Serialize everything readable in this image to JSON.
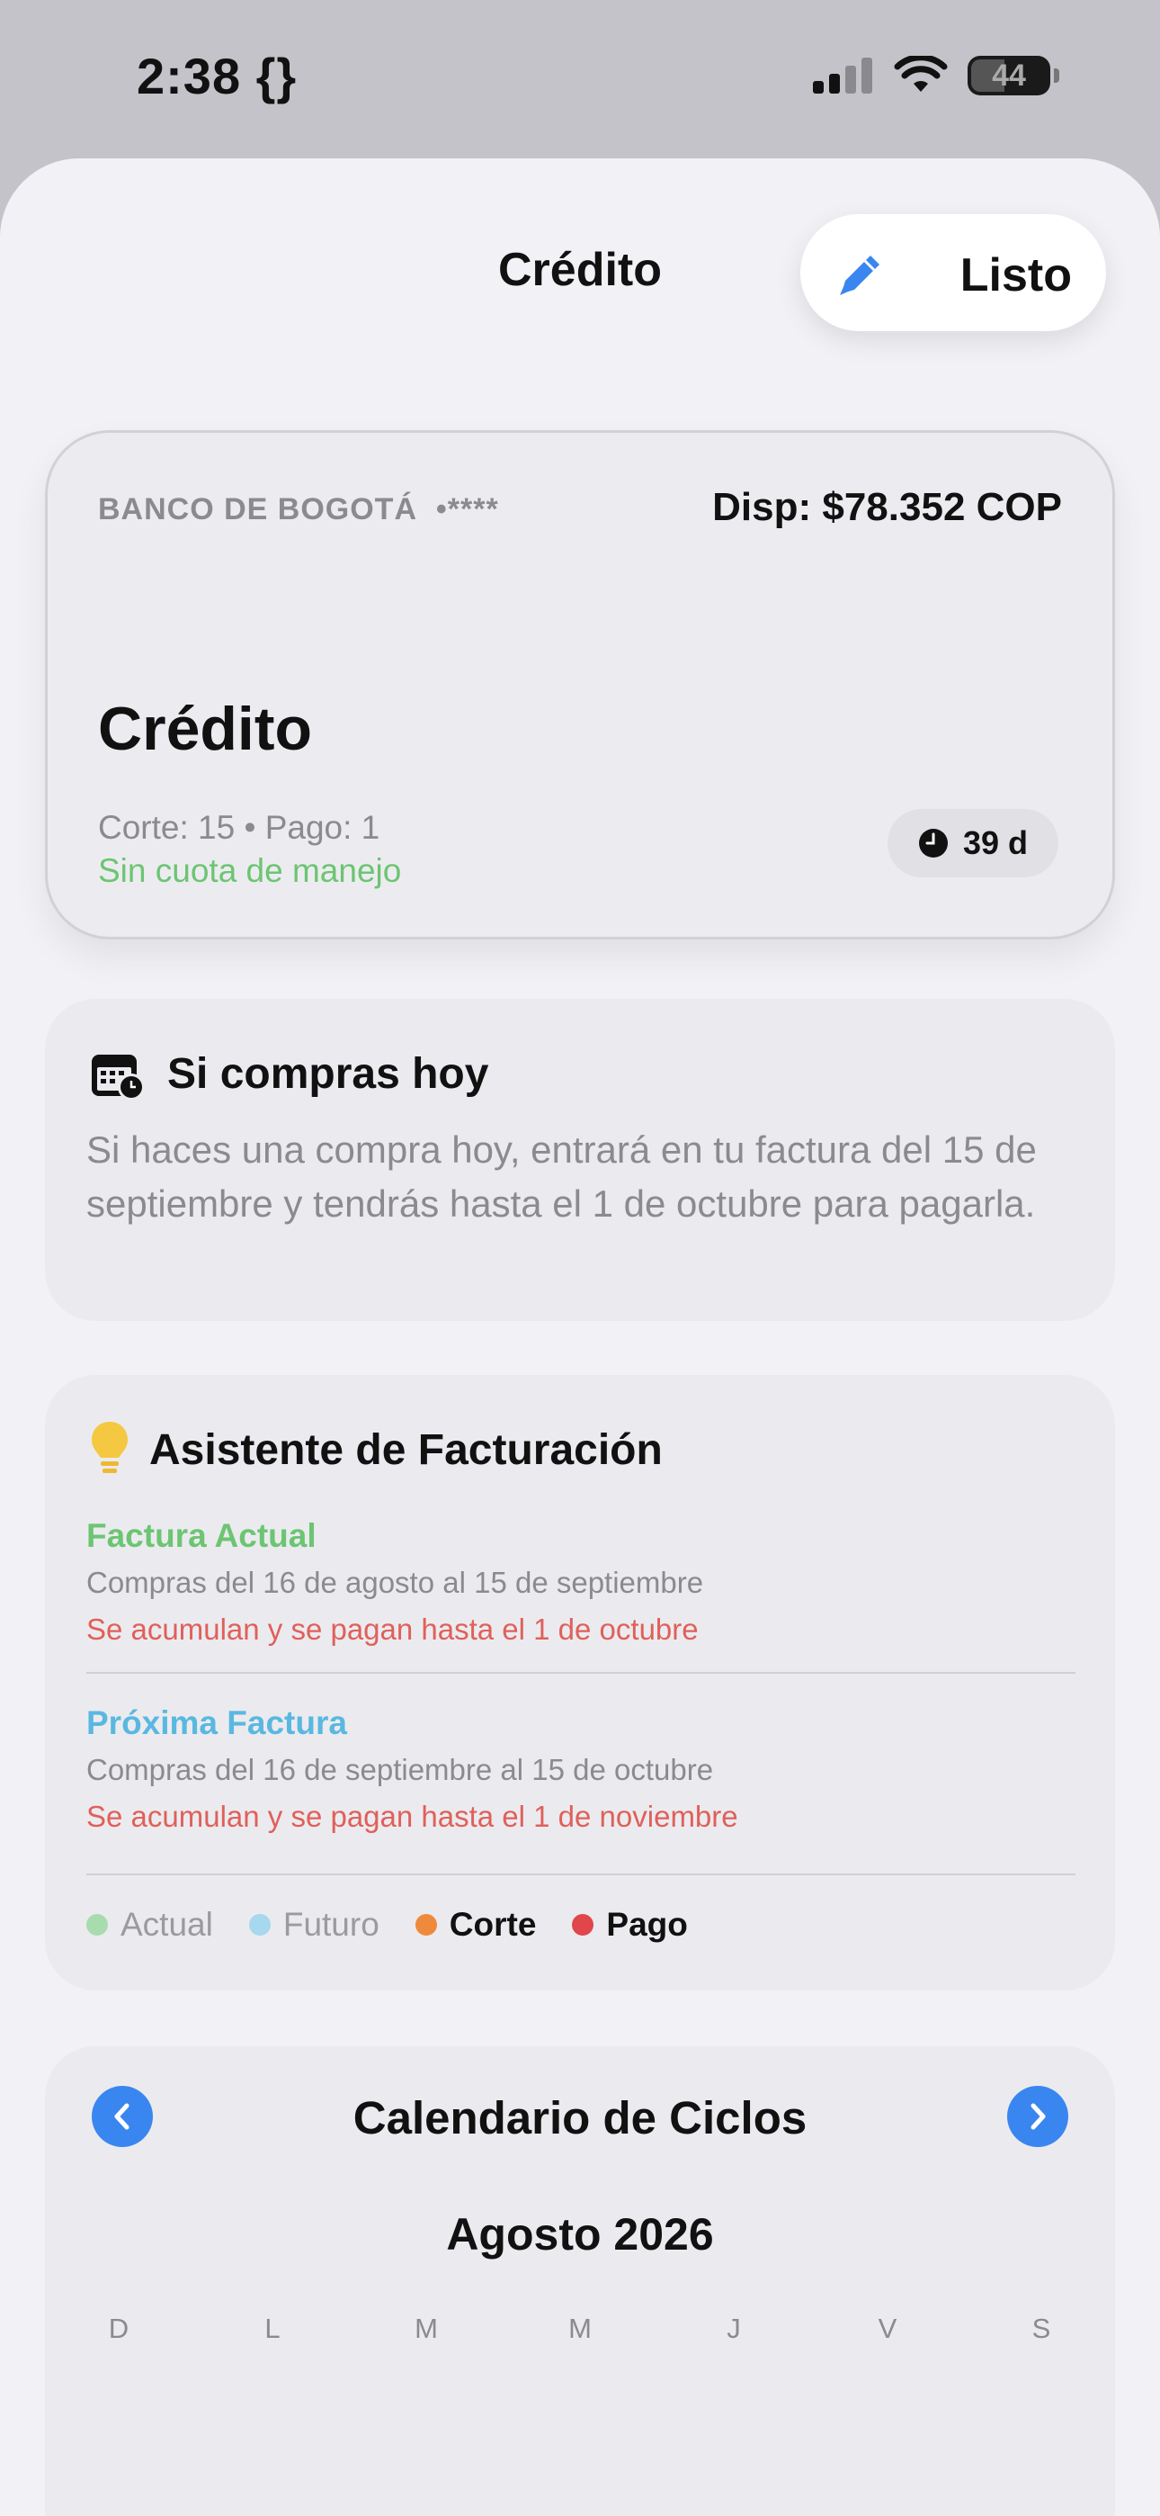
{
  "status_bar": {
    "time": "2:38 {}",
    "battery": "44",
    "icons": [
      "cellular-signal-icon",
      "wifi-icon",
      "battery-icon"
    ]
  },
  "nav": {
    "title": "Crédito",
    "done_label": "Listo",
    "edit_icon": "pencil-icon"
  },
  "card": {
    "bank": "BANCO DE BOGOTÁ",
    "masked_number": "•****",
    "available": "Disp: $78.352 COP",
    "title": "Crédito",
    "dates": "Corte: 15 • Pago: 1",
    "fee": "Sin cuota de manejo",
    "days": "39 d"
  },
  "buy_today": {
    "title": "Si compras hoy",
    "body": "Si haces una compra hoy, entrará en tu factura del 15 de septiembre y tendrás hasta el 1 de octubre para pagarla."
  },
  "assistant": {
    "title": "Asistente de Facturación",
    "current": {
      "name": "Factura Actual",
      "range": "Compras del 16 de agosto al 15 de septiembre",
      "due": "Se acumulan y se pagan hasta el 1 de octubre"
    },
    "next": {
      "name": "Próxima Factura",
      "range": "Compras del 16 de septiembre al 15 de octubre",
      "due": "Se acumulan y se pagan hasta el 1 de noviembre"
    },
    "legend": [
      {
        "label": "Actual",
        "color": "#a8dcae"
      },
      {
        "label": "Futuro",
        "color": "#a6d8ee"
      },
      {
        "label": "Corte",
        "color": "#ef8a3c"
      },
      {
        "label": "Pago",
        "color": "#e0464a"
      }
    ]
  },
  "calendar": {
    "title": "Calendario de Ciclos",
    "month": "Agosto 2026",
    "weekdays": [
      "D",
      "L",
      "M",
      "M",
      "J",
      "V",
      "S"
    ]
  },
  "colors": {
    "accent_blue": "#3a86f0",
    "green": "#6cc572",
    "cyan": "#5ab8e0",
    "red": "#e0605a",
    "bulb_yellow": "#f5c842"
  }
}
